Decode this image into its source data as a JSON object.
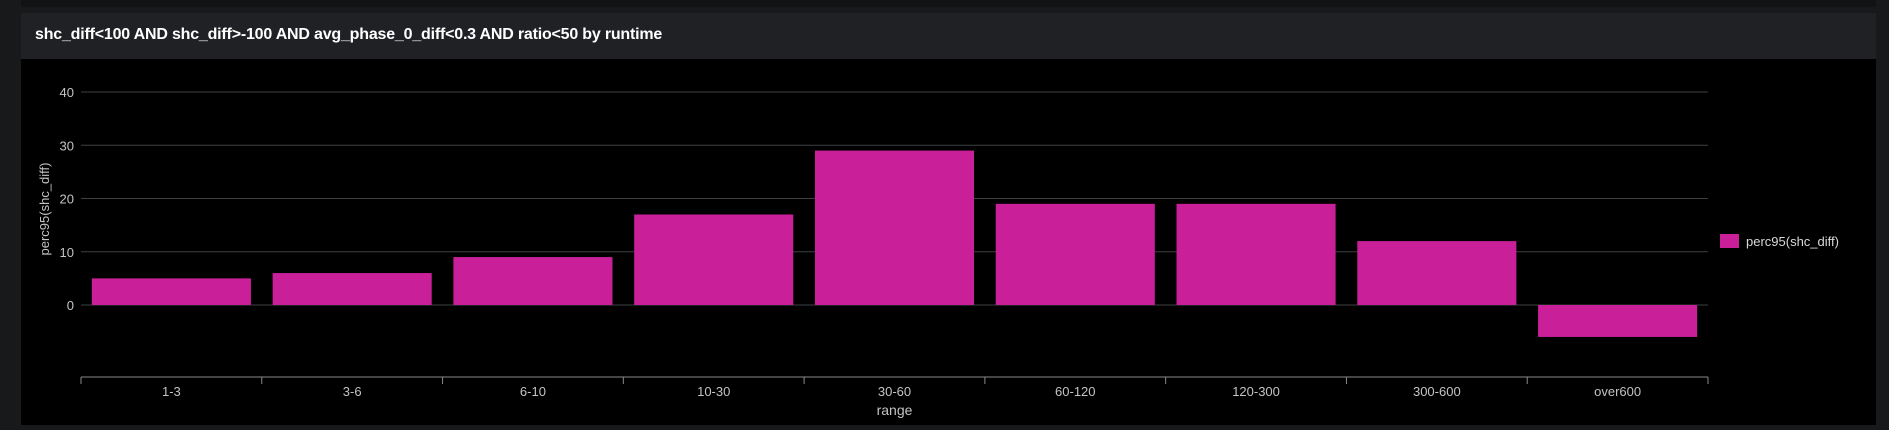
{
  "panel": {
    "title": "shc_diff<100 AND shc_diff>-100 AND avg_phase_0_diff<0.3 AND ratio<50 by runtime"
  },
  "colors": {
    "background": "#000000",
    "header": "#1f2124",
    "bar": "#c9209a",
    "gridline": "#3d3f42",
    "text": "#c3c3c3"
  },
  "chart_data": {
    "type": "bar",
    "categories": [
      "1-3",
      "3-6",
      "6-10",
      "10-30",
      "30-60",
      "60-120",
      "120-300",
      "300-600",
      "over600"
    ],
    "series": [
      {
        "name": "perc95(shc_diff)",
        "values": [
          5,
          6,
          9,
          17,
          29,
          19,
          19,
          12,
          -6
        ]
      }
    ],
    "xlabel": "range",
    "ylabel": "perc95(shc_diff)",
    "ylim": [
      -10,
      40
    ],
    "yticks": [
      0,
      10,
      20,
      30,
      40
    ],
    "grid": true,
    "legend_position": "right"
  }
}
